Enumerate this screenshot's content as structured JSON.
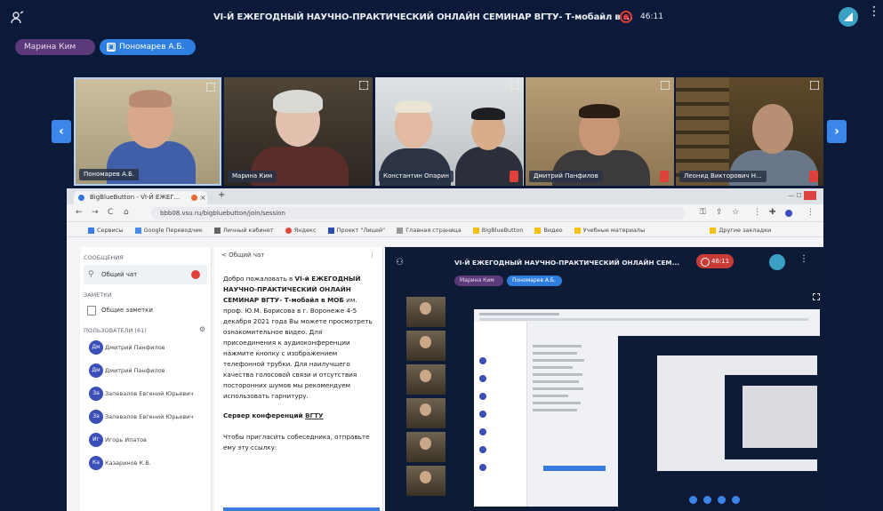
{
  "topbar": {
    "title": "VI-Й ЕЖЕГОДНЫЙ НАУЧНО-ПРАКТИЧЕСКИЙ ОНЛАЙН СЕМИНАР ВГТУ- Т-мобайл в ...",
    "recording_time": "46:11"
  },
  "presenters": [
    {
      "label": "Марина Ким"
    },
    {
      "label": "Пономарев А.Б."
    }
  ],
  "videos": [
    {
      "name": "Пономарев А.Б."
    },
    {
      "name": "Марина Ким"
    },
    {
      "name": "Константин Опарин"
    },
    {
      "name": "Дмитрий Панфилов"
    },
    {
      "name": "Леонид Викторович Н..."
    }
  ],
  "browser": {
    "tab_title": "BigBlueButton - VI-Й ЕЖЕГ...",
    "url": "bbb08.vsu.ru/bigbluebutton/join/session",
    "bookmarks": [
      "Сервисы",
      "Google Переводчик",
      "Личный кабинет",
      "Яндекс",
      "Проект \"Лицей\"",
      "Главная страница",
      "BigBlueButton",
      "Видео",
      "Учебные материалы"
    ],
    "bookmarks_right": "Другие закладки"
  },
  "sidebar": {
    "messages_header": "СООБЩЕНИЯ",
    "public_chat": "Общий чат",
    "notes_header": "ЗАМЕТКИ",
    "shared_notes": "Общие заметки",
    "users_header": "ПОЛЬЗОВАТЕЛИ (61)",
    "users": [
      {
        "initials": "Дм",
        "name": "Дмитрий Панфилов"
      },
      {
        "initials": "Дм",
        "name": "Дмитрий Панфилов"
      },
      {
        "initials": "За",
        "name": "Запевалов Евгений Юрьевич"
      },
      {
        "initials": "За",
        "name": "Запевалов Евгений Юрьевич"
      },
      {
        "initials": "Иг",
        "name": "Игорь Ипатов"
      },
      {
        "initials": "Ка",
        "name": "Казаринов К.В."
      }
    ]
  },
  "chat": {
    "header": "< Общий чат",
    "welcome_prefix": "Добро пожаловать в",
    "welcome_bold": "VI-й ЕЖЕГОДНЫЙ НАУЧНО-ПРАКТИЧЕСКИЙ ОНЛАЙН СЕМИНАР ВГТУ- Т-мобайл в МОБ",
    "welcome_rest": "им. проф. Ю.М. Борисова в г. Воронеже 4-5 декабря 2021 года Вы можете просмотреть ознакомительное видео. Для присоединения к аудиоконференции нажмите кнопку с изображением телефонной трубки. Для наилучшего качества голосовой связи и отсутствия посторонних шумов мы рекомендуем использовать гарнитуру.",
    "server_label": "Сервер конференций",
    "server_link": "ВГТУ",
    "invite_text": "Чтобы пригласить собеседника, отправьте ему эту ссылку:"
  },
  "inner": {
    "title": "VI-Й ЕЖЕГОДНЫЙ НАУЧНО-ПРАКТИЧЕСКИЙ ОНЛАЙН СЕМ...",
    "recording_time": "46:11",
    "chip1": "Марина Ким",
    "chip2": "Пономарев А.Б."
  },
  "colors": {
    "background": "#0b1a38",
    "accent_blue": "#2f7fe0",
    "presenter_purple": "#5c3a79",
    "record_red": "#e23a3a"
  }
}
